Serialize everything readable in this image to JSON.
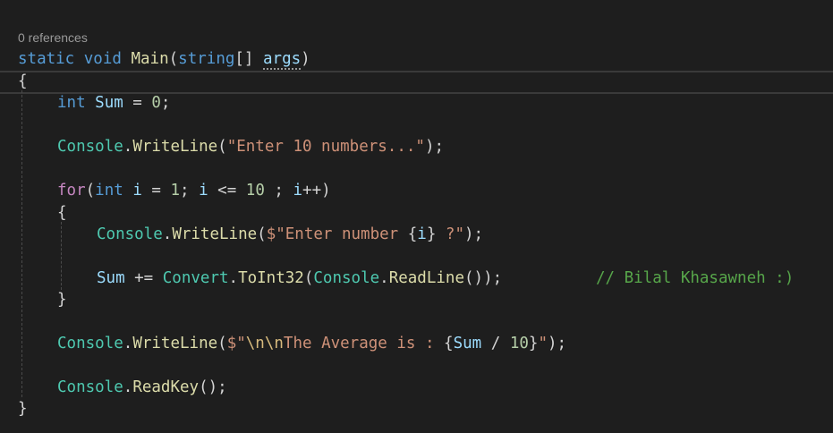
{
  "codelens": "0 references",
  "tokens": {
    "static": "static",
    "void": "void",
    "main": "Main",
    "paren_open": "(",
    "string_type": "string",
    "brackets": "[]",
    "space": " ",
    "args": "args",
    "paren_close": ")",
    "brace_open": "{",
    "brace_close": "}",
    "int": "int",
    "sum": "Sum",
    "assign_eq": " = ",
    "zero": "0",
    "semicolon": ";",
    "console": "Console",
    "dot": ".",
    "writeline": "WriteLine",
    "str_enter10": "\"Enter 10 numbers...\"",
    "close_call": ");",
    "for": "for",
    "i": "i",
    "one": "1",
    "semi_sp": "; ",
    "le": " <= ",
    "ten": "10",
    "sp_semi_sp": " ; ",
    "incr": "++",
    "interp_open": "$\"Enter number ",
    "curly_open": "{",
    "curly_close": "}",
    "interp_q": " ?\"",
    "plus_eq": " += ",
    "convert": "Convert",
    "toint32": "ToInt32",
    "readline": "ReadLine",
    "call_end": "());",
    "comment": "// Bilal Khasawneh :)",
    "interp_avg_open": "$\"",
    "esc_nn": "\\n\\n",
    "str_avg": "The Average is : ",
    "div": " / ",
    "str_close": "\"",
    "readkey": "ReadKey",
    "empty_call": "();"
  }
}
